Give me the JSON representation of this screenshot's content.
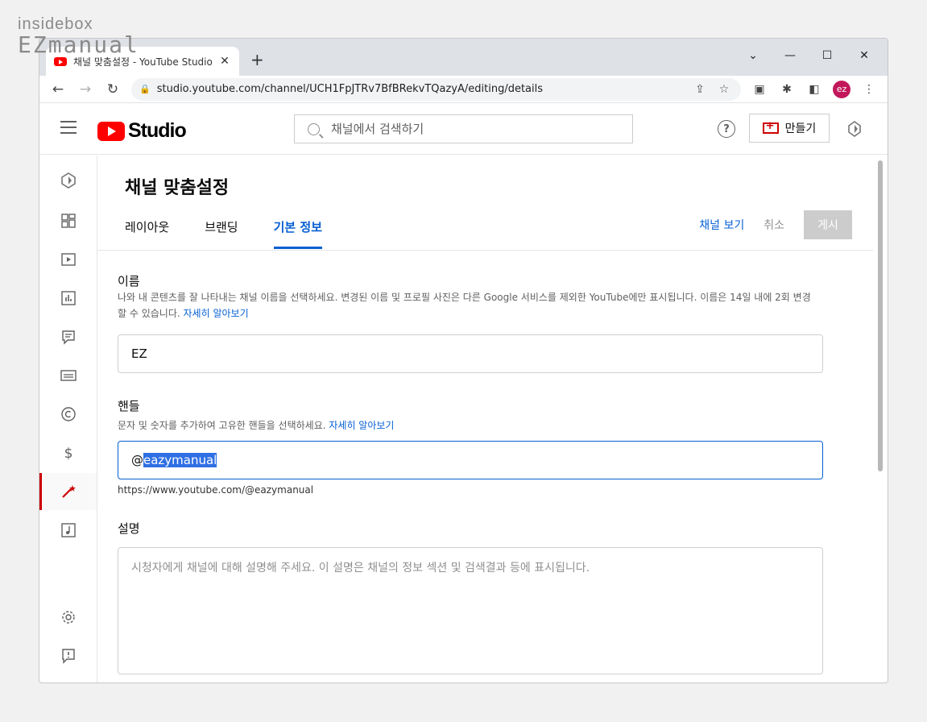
{
  "watermark": {
    "line1": "insidebox",
    "line2": "EZmanual"
  },
  "browser": {
    "tab_title": "채널 맞춤설정 - YouTube Studio",
    "url": "studio.youtube.com/channel/UCH1FpJTRv7BfBRekvTQazyA/editing/details",
    "profile_initials": "ez"
  },
  "header": {
    "logo_text": "Studio",
    "search_placeholder": "채널에서 검색하기",
    "help_glyph": "?",
    "create_label": "만들기"
  },
  "page": {
    "title": "채널 맞춤설정",
    "tabs": [
      {
        "label": "레이아웃",
        "active": false
      },
      {
        "label": "브랜딩",
        "active": false
      },
      {
        "label": "기본 정보",
        "active": true
      }
    ],
    "view_channel": "채널 보기",
    "cancel": "취소",
    "publish": "게시"
  },
  "name_section": {
    "label": "이름",
    "desc": "나와 내 콘텐츠를 잘 나타내는 채널 이름을 선택하세요. 변경된 이름 및 프로필 사진은 다른 Google 서비스를 제외한 YouTube에만 표시됩니다. 이름은 14일 내에 2회 변경할 수 있습니다.",
    "learn_more": "자세히 알아보기",
    "value": "EZ"
  },
  "handle_section": {
    "label": "핸들",
    "desc": "문자 및 숫자를 추가하여 고유한 핸들을 선택하세요.",
    "learn_more": "자세히 알아보기",
    "prefix": "@",
    "value": "eazymanual",
    "url": "https://www.youtube.com/@eazymanual"
  },
  "description_section": {
    "label": "설명",
    "placeholder": "시청자에게 채널에 대해 설명해 주세요. 이 설명은 채널의 정보 섹션 및 검색결과 등에 표시됩니다."
  }
}
